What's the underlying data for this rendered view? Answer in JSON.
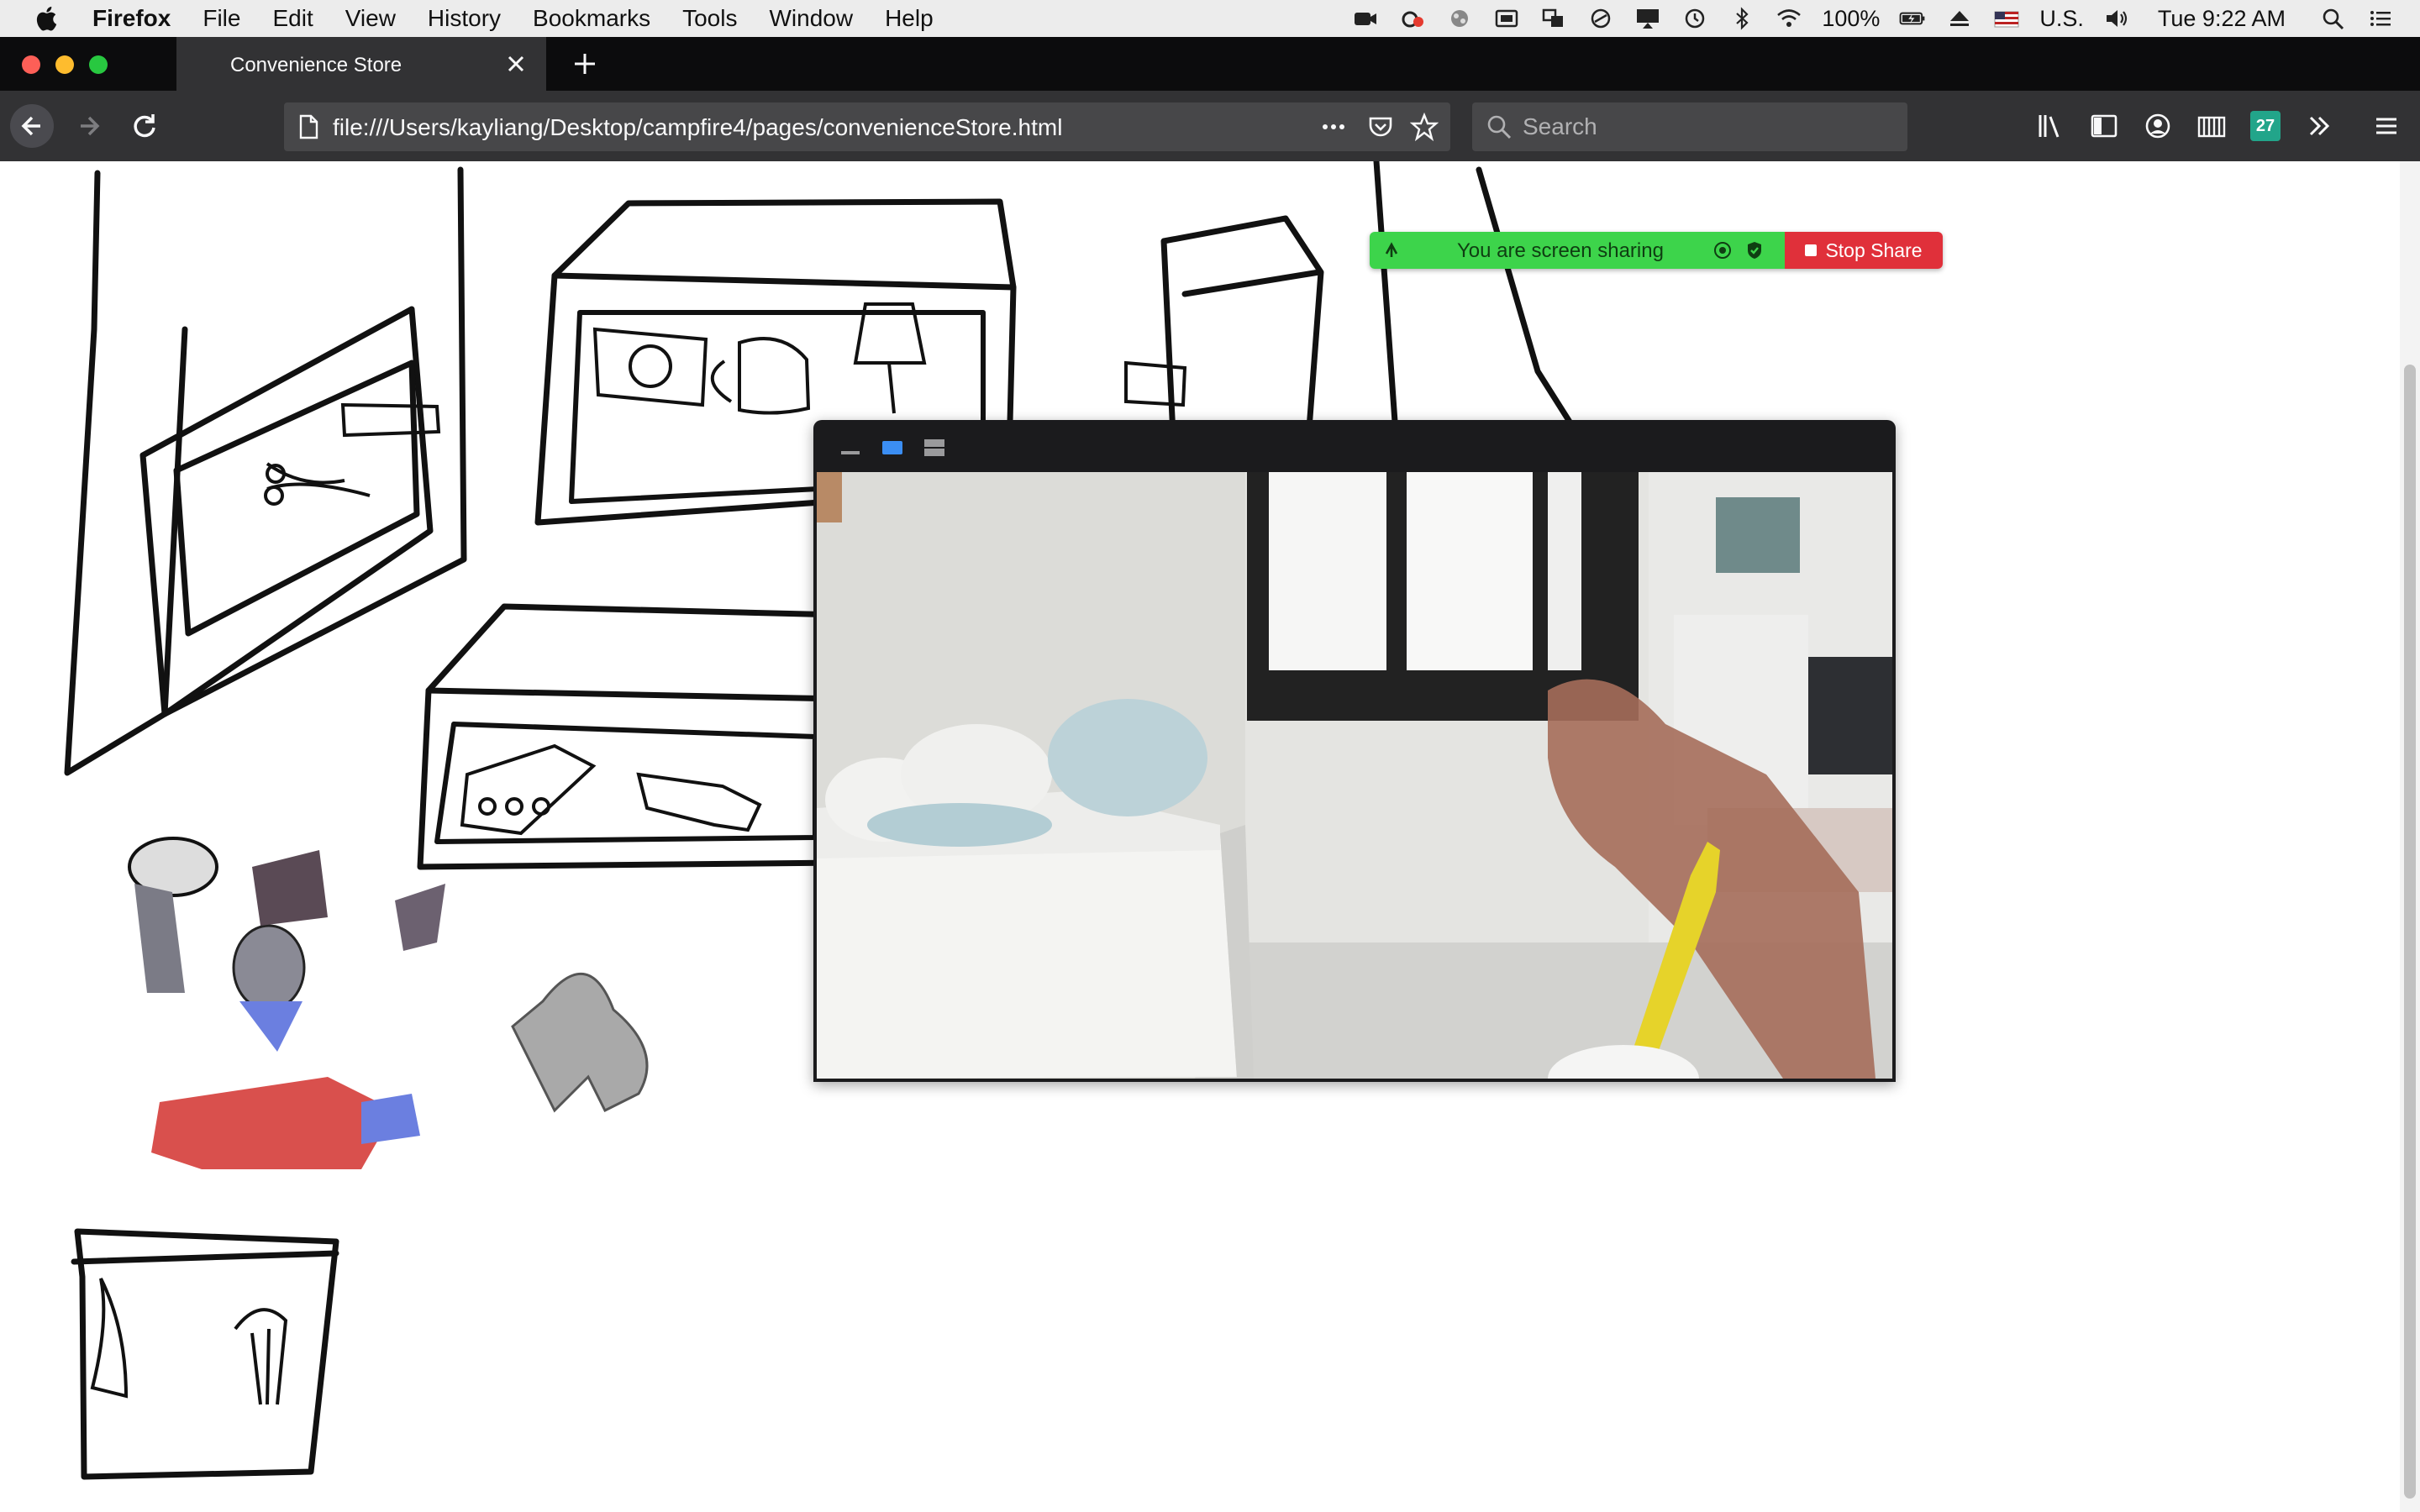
{
  "menubar": {
    "app_name": "Firefox",
    "items": [
      "File",
      "Edit",
      "View",
      "History",
      "Bookmarks",
      "Tools",
      "Window",
      "Help"
    ],
    "battery": "100%",
    "input_source": "U.S.",
    "clock": "Tue 9:22 AM"
  },
  "browser": {
    "tab_title": "Convenience Store",
    "url": "file:///Users/kayliang/Desktop/campfire4/pages/convenienceStore.html",
    "search_placeholder": "Search",
    "badge_count": "27"
  },
  "share_bar": {
    "status_text": "You are screen sharing",
    "stop_label": "Stop Share",
    "colors": {
      "active": "#3dd44b",
      "stop": "#e0303a"
    }
  },
  "theme": {
    "tab_strip": "#0c0c0d",
    "toolbar": "#323234",
    "url_field": "#474749"
  }
}
